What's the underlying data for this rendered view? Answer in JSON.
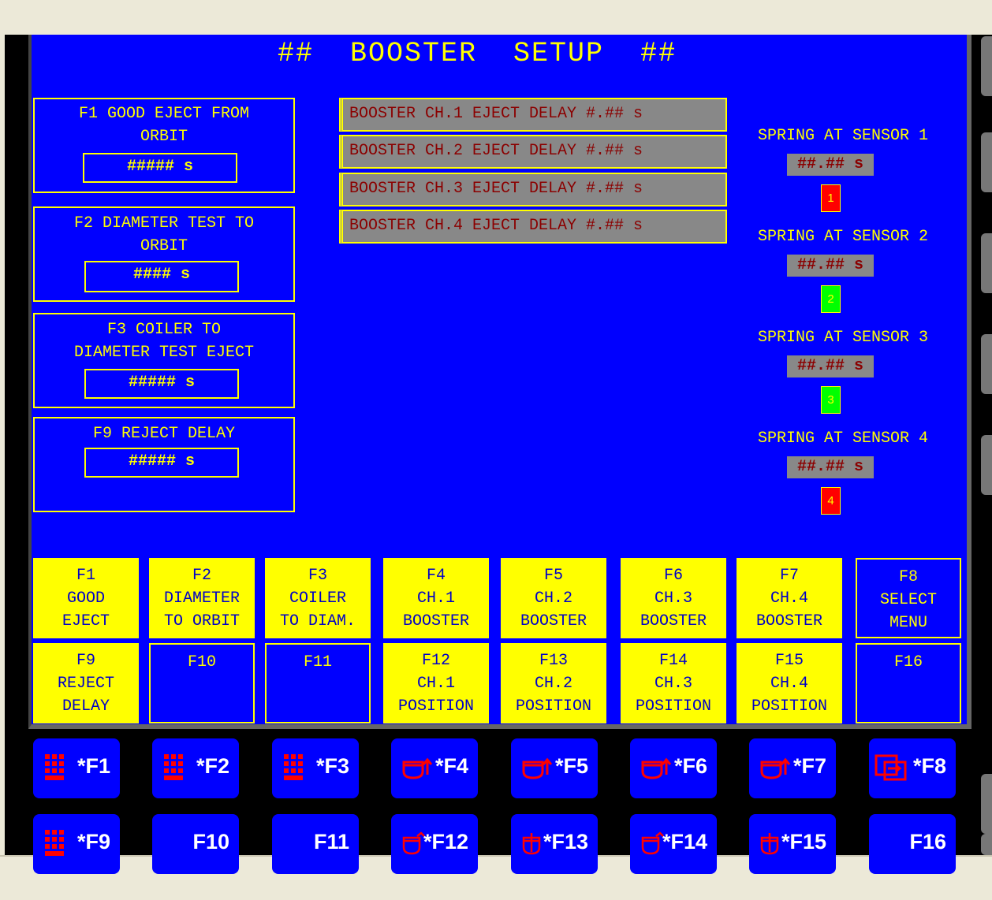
{
  "title": "##  BOOSTER  SETUP  ##",
  "timers": [
    {
      "label_lines": [
        "F1 GOOD EJECT FROM",
        "ORBIT"
      ],
      "value": "##### s"
    },
    {
      "label_lines": [
        "F2 DIAMETER TEST TO",
        "ORBIT"
      ],
      "value": "#### s"
    },
    {
      "label_lines": [
        "F3 COILER TO",
        "DIAMETER TEST EJECT"
      ],
      "value": "##### s"
    },
    {
      "label_lines": [
        "F9 REJECT DELAY"
      ],
      "value": "##### s"
    }
  ],
  "booster_delays": [
    "BOOSTER CH.1 EJECT DELAY #.## s",
    "BOOSTER CH.2 EJECT DELAY #.## s",
    "BOOSTER CH.3 EJECT DELAY #.## s",
    "BOOSTER CH.4 EJECT DELAY #.## s"
  ],
  "sensors": [
    {
      "label": "SPRING AT SENSOR 1",
      "value": "##.## s",
      "indicator": "1",
      "color": "#ff0000"
    },
    {
      "label": "SPRING AT SENSOR 2",
      "value": "##.## s",
      "indicator": "2",
      "color": "#00ff00"
    },
    {
      "label": "SPRING AT SENSOR 3",
      "value": "##.## s",
      "indicator": "3",
      "color": "#00ff00"
    },
    {
      "label": "SPRING AT SENSOR 4",
      "value": "##.## s",
      "indicator": "4",
      "color": "#ff0000"
    }
  ],
  "function_keys_row1": [
    {
      "text": "F1\nGOOD\nEJECT",
      "active": true
    },
    {
      "text": "F2\nDIAMETER\nTO ORBIT",
      "active": true
    },
    {
      "text": "F3\nCOILER\nTO DIAM.",
      "active": true
    },
    {
      "text": "F4\nCH.1\nBOOSTER",
      "active": true
    },
    {
      "text": "F5\nCH.2\nBOOSTER",
      "active": true
    },
    {
      "text": "F6\nCH.3\nBOOSTER",
      "active": true
    },
    {
      "text": "F7\nCH.4\nBOOSTER",
      "active": true
    },
    {
      "text": "F8\nSELECT\nMENU",
      "active": false
    }
  ],
  "function_keys_row2": [
    {
      "text": "F9\nREJECT\nDELAY",
      "active": true
    },
    {
      "text": "F10",
      "active": false
    },
    {
      "text": "F11",
      "active": false
    },
    {
      "text": "F12\nCH.1\nPOSITION",
      "active": true
    },
    {
      "text": "F13\nCH.2\nPOSITION",
      "active": true
    },
    {
      "text": "F14\nCH.3\nPOSITION",
      "active": true
    },
    {
      "text": "F15\nCH.4\nPOSITION",
      "active": true
    },
    {
      "text": "F16",
      "active": false
    }
  ],
  "hardware_keys_row1": [
    {
      "label": "*F1",
      "icon": "keypad-icon"
    },
    {
      "label": "*F2",
      "icon": "keypad-icon"
    },
    {
      "label": "*F3",
      "icon": "keypad-icon"
    },
    {
      "label": "*F4",
      "icon": "booster-icon"
    },
    {
      "label": "*F5",
      "icon": "booster-icon"
    },
    {
      "label": "*F6",
      "icon": "booster-icon"
    },
    {
      "label": "*F7",
      "icon": "booster-icon"
    },
    {
      "label": "*F8",
      "icon": "menu-screens-icon"
    }
  ],
  "hardware_keys_row2": [
    {
      "label": "*F9",
      "icon": "keypad-icon"
    },
    {
      "label": "F10",
      "icon": ""
    },
    {
      "label": "F11",
      "icon": ""
    },
    {
      "label": "*F12",
      "icon": "position-icon"
    },
    {
      "label": "*F13",
      "icon": "position-icon"
    },
    {
      "label": "*F14",
      "icon": "position-icon"
    },
    {
      "label": "*F15",
      "icon": "position-icon"
    },
    {
      "label": "F16",
      "icon": ""
    }
  ],
  "colors": {
    "panel": "#0000ff",
    "text": "#ffff00",
    "key_active": "#ffff00",
    "key_text": "#0000c8",
    "value_bg": "#888888",
    "value_text": "#8b0000"
  }
}
